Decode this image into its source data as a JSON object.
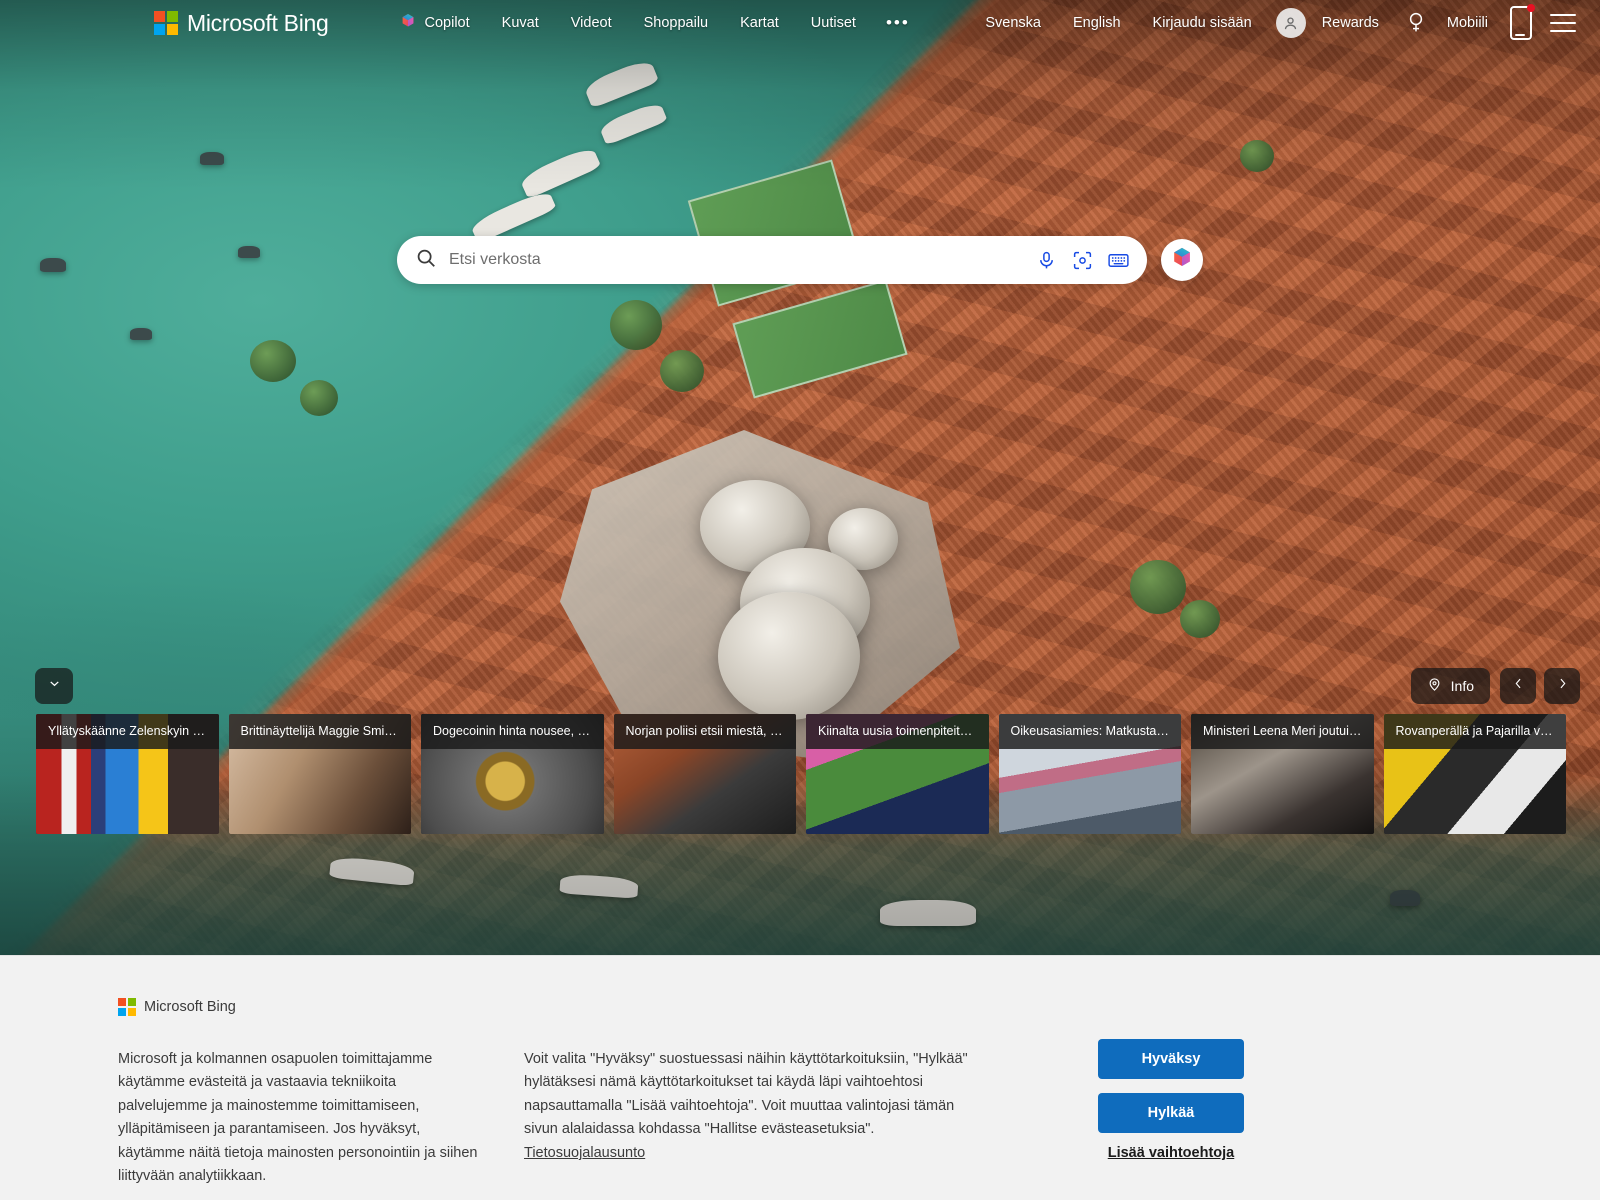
{
  "header": {
    "brand": "Microsoft Bing",
    "brand_logo_icon": "microsoft-logo-icon",
    "primary_nav": [
      {
        "label": "Copilot",
        "icon": "copilot-icon"
      },
      {
        "label": "Kuvat",
        "icon": ""
      },
      {
        "label": "Videot",
        "icon": ""
      },
      {
        "label": "Shoppailu",
        "icon": ""
      },
      {
        "label": "Kartat",
        "icon": ""
      },
      {
        "label": "Uutiset",
        "icon": ""
      }
    ],
    "more_label": "•••",
    "secondary_nav": [
      {
        "label": "Svenska"
      },
      {
        "label": "English"
      },
      {
        "label": "Kirjaudu sisään"
      },
      {
        "label": "Rewards"
      },
      {
        "label": "Mobiili"
      }
    ],
    "avatar_icon": "person-avatar-icon",
    "rewards_icon": "rewards-medal-icon",
    "mobile_icon": "mobile-phone-icon",
    "menu_icon": "hamburger-menu-icon"
  },
  "search": {
    "placeholder": "Etsi verkosta",
    "value": "",
    "search_icon": "search-icon",
    "mic_icon": "microphone-icon",
    "lens_icon": "visual-search-camera-icon",
    "keyboard_icon": "keyboard-icon",
    "copilot_icon": "copilot-icon"
  },
  "hero_controls": {
    "collapse_icon": "chevron-down-icon",
    "info_label": "Info",
    "info_icon": "location-pin-icon",
    "prev_icon": "chevron-left-icon",
    "next_icon": "chevron-right-icon"
  },
  "news": {
    "cards": [
      {
        "title": "Yllätyskäänne Zelenskyin …",
        "thumb": "t-zelensky"
      },
      {
        "title": "Brittinäyttelijä Maggie Smi…",
        "thumb": "t-maggie"
      },
      {
        "title": "Dogecoinin hinta nousee, …",
        "thumb": "t-doge"
      },
      {
        "title": "Norjan poliisi etsii miestä, …",
        "thumb": "t-norja"
      },
      {
        "title": "Kiinalta uusia toimenpiteit…",
        "thumb": "t-kiina"
      },
      {
        "title": "Oikeusasiamies: Matkusta…",
        "thumb": "t-oikeus"
      },
      {
        "title": "Ministeri Leena Meri joutui…",
        "thumb": "t-leena"
      },
      {
        "title": "Rovanperällä ja Pajarilla v…",
        "thumb": "t-rova"
      }
    ]
  },
  "cookie_banner": {
    "brand": "Microsoft Bing",
    "paragraph_1": "Microsoft ja kolmannen osapuolen toimittajamme käytämme evästeitä ja vastaavia tekniikoita palvelujemme ja mainostemme toimittamiseen, ylläpitämiseen ja parantamiseen. Jos hyväksyt, käytämme näitä tietoja mainosten personointiin ja siihen liittyvään analytiikkaan.",
    "paragraph_2": "Voit valita \"Hyväksy\" suostuessasi näihin käyttötarkoituksiin, \"Hylkää\" hylätäksesi nämä käyttötarkoitukset tai käydä läpi vaihtoehtosi napsauttamalla \"Lisää vaihtoehtoja\". Voit muuttaa valintojasi tämän sivun alalaidassa kohdassa \"Hallitse evästeasetuksia\". ",
    "privacy_link": "Tietosuojalausunto",
    "accept_label": "Hyväksy",
    "reject_label": "Hylkää",
    "more_options_label": "Lisää vaihtoehtoja"
  },
  "colors": {
    "accent_blue": "#0f6cbd",
    "search_icon_blue": "#174ae4",
    "banner_bg": "#f2f2f2",
    "pill_bg": "rgba(22,22,22,.72)",
    "water_teal": "#3f9a89",
    "roof_orange": "#b8603a"
  }
}
